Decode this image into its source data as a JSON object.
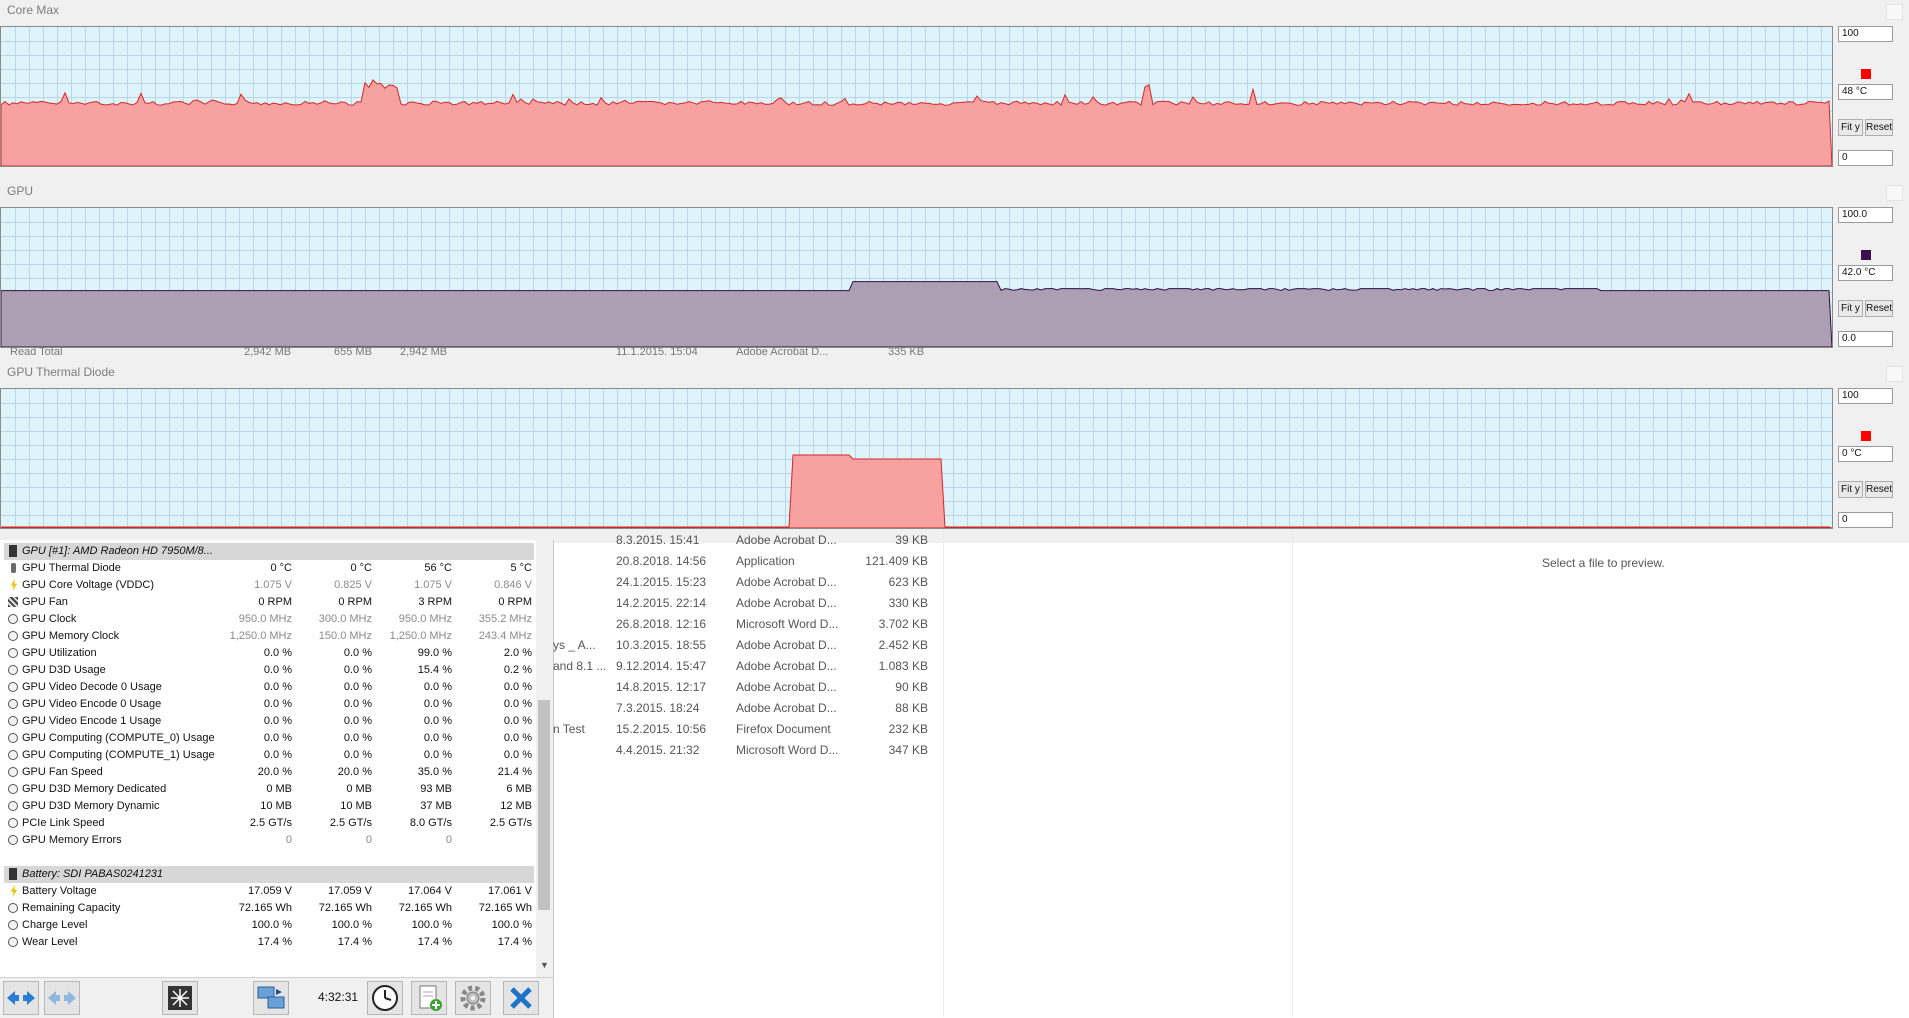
{
  "graphs": [
    {
      "title": "Core Max",
      "max_label": "100",
      "current_label": "48 °C",
      "min_label": "0",
      "color": "#ff0000",
      "fill": "#f7a1a1",
      "line": "#d02828",
      "fit_label": "Fit y",
      "reset_label": "Reset",
      "level_pct": 48
    },
    {
      "title": "GPU",
      "max_label": "100.0",
      "current_label": "42.0 °C",
      "min_label": "0.0",
      "color": "#3a1050",
      "fill": "#ad9fb3",
      "line": "#2b1040",
      "fit_label": "Fit y",
      "reset_label": "Reset",
      "level_pct": 42
    },
    {
      "title": "GPU Thermal Diode",
      "max_label": "100",
      "current_label": "0 °C",
      "min_label": "0",
      "color": "#ff0000",
      "fill": "#f7a1a1",
      "line": "#d02828",
      "fit_label": "Fit y",
      "reset_label": "Reset",
      "level_pct": 0
    }
  ],
  "background_fragments": {
    "row1_cols": [
      "Read Total",
      "2,942 MB",
      "655 MB",
      "2,942 MB"
    ],
    "row1_file": [
      "11.1.2015. 15:04",
      "Adobe Acrobat D...",
      "335 KB"
    ]
  },
  "sensors": {
    "gpu_header": "GPU [#1]: AMD Radeon HD 7950M/8...",
    "gpu_rows": [
      {
        "icon": "therm",
        "name": "GPU Thermal Diode",
        "v": [
          "0 °C",
          "0 °C",
          "56 °C",
          "5 °C"
        ],
        "dim": false
      },
      {
        "icon": "bolt",
        "name": "GPU Core Voltage (VDDC)",
        "v": [
          "1.075 V",
          "0.825 V",
          "1.075 V",
          "0.846 V"
        ],
        "dim": true
      },
      {
        "icon": "fan",
        "name": "GPU Fan",
        "v": [
          "0 RPM",
          "0 RPM",
          "3 RPM",
          "0 RPM"
        ],
        "dim": false
      },
      {
        "icon": "circ",
        "name": "GPU Clock",
        "v": [
          "950.0 MHz",
          "300.0 MHz",
          "950.0 MHz",
          "355.2 MHz"
        ],
        "dim": true
      },
      {
        "icon": "circ",
        "name": "GPU Memory Clock",
        "v": [
          "1,250.0 MHz",
          "150.0 MHz",
          "1,250.0 MHz",
          "243.4 MHz"
        ],
        "dim": true
      },
      {
        "icon": "circ",
        "name": "GPU Utilization",
        "v": [
          "0.0 %",
          "0.0 %",
          "99.0 %",
          "2.0 %"
        ],
        "dim": false
      },
      {
        "icon": "circ",
        "name": "GPU D3D Usage",
        "v": [
          "0.0 %",
          "0.0 %",
          "15.4 %",
          "0.2 %"
        ],
        "dim": false
      },
      {
        "icon": "circ",
        "name": "GPU Video Decode 0 Usage",
        "v": [
          "0.0 %",
          "0.0 %",
          "0.0 %",
          "0.0 %"
        ],
        "dim": false
      },
      {
        "icon": "circ",
        "name": "GPU Video Encode 0 Usage",
        "v": [
          "0.0 %",
          "0.0 %",
          "0.0 %",
          "0.0 %"
        ],
        "dim": false
      },
      {
        "icon": "circ",
        "name": "GPU Video Encode 1 Usage",
        "v": [
          "0.0 %",
          "0.0 %",
          "0.0 %",
          "0.0 %"
        ],
        "dim": false
      },
      {
        "icon": "circ",
        "name": "GPU Computing (COMPUTE_0) Usage",
        "v": [
          "0.0 %",
          "0.0 %",
          "0.0 %",
          "0.0 %"
        ],
        "dim": false
      },
      {
        "icon": "circ",
        "name": "GPU Computing (COMPUTE_1) Usage",
        "v": [
          "0.0 %",
          "0.0 %",
          "0.0 %",
          "0.0 %"
        ],
        "dim": false
      },
      {
        "icon": "circ",
        "name": "GPU Fan Speed",
        "v": [
          "20.0 %",
          "20.0 %",
          "35.0 %",
          "21.4 %"
        ],
        "dim": false
      },
      {
        "icon": "circ",
        "name": "GPU D3D Memory Dedicated",
        "v": [
          "0 MB",
          "0 MB",
          "93 MB",
          "6 MB"
        ],
        "dim": false
      },
      {
        "icon": "circ",
        "name": "GPU D3D Memory Dynamic",
        "v": [
          "10 MB",
          "10 MB",
          "37 MB",
          "12 MB"
        ],
        "dim": false
      },
      {
        "icon": "circ",
        "name": "PCIe Link Speed",
        "v": [
          "2.5 GT/s",
          "2.5 GT/s",
          "8.0 GT/s",
          "2.5 GT/s"
        ],
        "dim": false
      },
      {
        "icon": "circ",
        "name": "GPU Memory Errors",
        "v": [
          "0",
          "0",
          "0",
          ""
        ],
        "dim": true
      }
    ],
    "battery_header": "Battery: SDI PABAS0241231",
    "battery_rows": [
      {
        "icon": "bolt",
        "name": "Battery Voltage",
        "v": [
          "17.059 V",
          "17.059 V",
          "17.064 V",
          "17.061 V"
        ],
        "dim": false
      },
      {
        "icon": "circ",
        "name": "Remaining Capacity",
        "v": [
          "72.165 Wh",
          "72.165 Wh",
          "72.165 Wh",
          "72.165 Wh"
        ],
        "dim": false
      },
      {
        "icon": "circ",
        "name": "Charge Level",
        "v": [
          "100.0 %",
          "100.0 %",
          "100.0 %",
          "100.0 %"
        ],
        "dim": false
      },
      {
        "icon": "circ",
        "name": "Wear Level",
        "v": [
          "17.4 %",
          "17.4 %",
          "17.4 %",
          "17.4 %"
        ],
        "dim": false
      }
    ]
  },
  "toolbar": {
    "time": "4:32:31",
    "icons": [
      "nav-arrows-icon",
      "nav-arrows-disabled-icon",
      "network-icon",
      "transfer-icon",
      "clock-icon",
      "add-report-icon",
      "settings-icon",
      "close-icon"
    ]
  },
  "files": [
    {
      "clip": "",
      "date": "8.3.2015. 15:41",
      "type": "Adobe Acrobat D...",
      "size": "39 KB"
    },
    {
      "clip": "",
      "date": "20.8.2018. 14:56",
      "type": "Application",
      "size": "121.409 KB"
    },
    {
      "clip": "",
      "date": "24.1.2015. 15:23",
      "type": "Adobe Acrobat D...",
      "size": "623 KB"
    },
    {
      "clip": "",
      "date": "14.2.2015. 22:14",
      "type": "Adobe Acrobat D...",
      "size": "330 KB"
    },
    {
      "clip": "",
      "date": "26.8.2018. 12:16",
      "type": "Microsoft Word D...",
      "size": "3.702 KB"
    },
    {
      "clip": "ys _ A...",
      "date": "10.3.2015. 18:55",
      "type": "Adobe Acrobat D...",
      "size": "2.452 KB"
    },
    {
      "clip": "and 8.1 ...",
      "date": "9.12.2014. 15:47",
      "type": "Adobe Acrobat D...",
      "size": "1.083 KB"
    },
    {
      "clip": "",
      "date": "14.8.2015. 12:17",
      "type": "Adobe Acrobat D...",
      "size": "90 KB"
    },
    {
      "clip": "",
      "date": "7.3.2015. 18:24",
      "type": "Adobe Acrobat D...",
      "size": "88 KB"
    },
    {
      "clip": "n Test",
      "date": "15.2.2015. 10:56",
      "type": "Firefox Document",
      "size": "232 KB"
    },
    {
      "clip": "",
      "date": "4.4.2015. 21:32",
      "type": "Microsoft Word D...",
      "size": "347 KB"
    }
  ],
  "preview_text": "Select a file to preview."
}
